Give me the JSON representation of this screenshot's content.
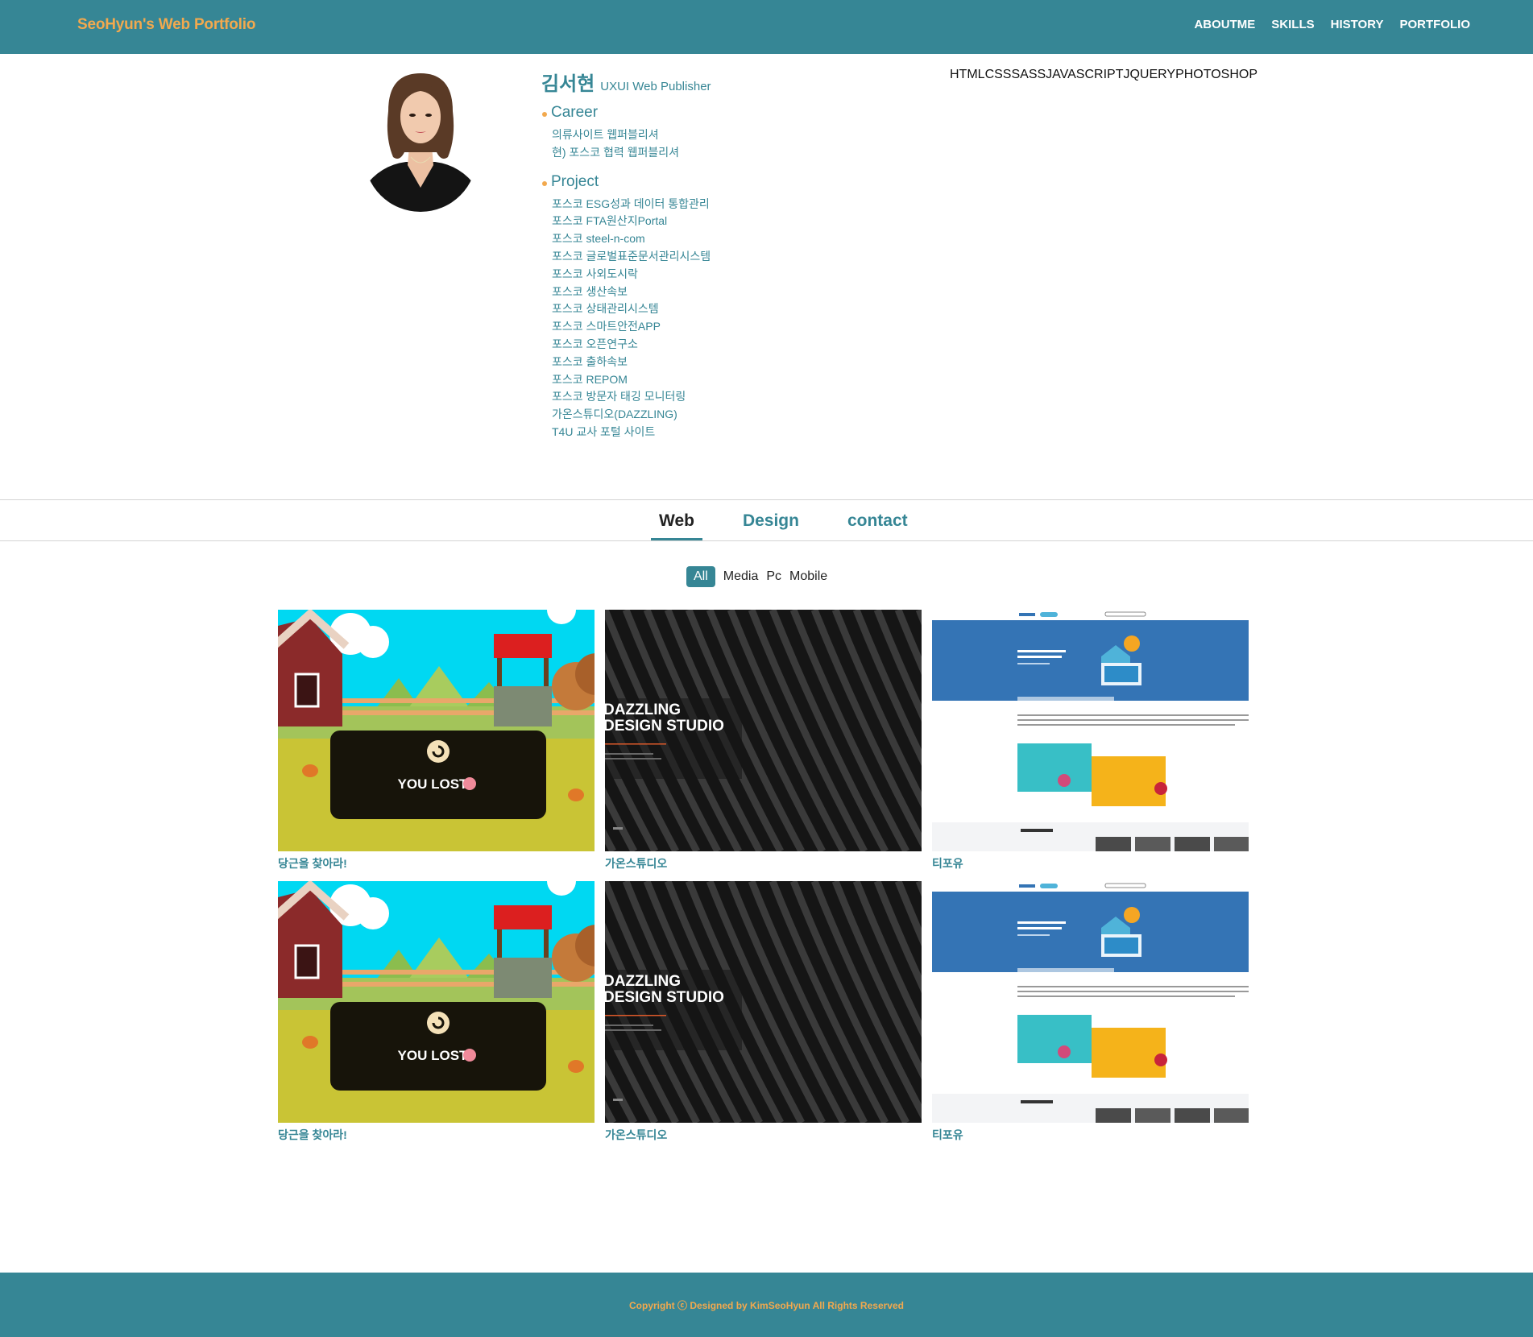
{
  "header": {
    "brand": "SeoHyun's Web Portfolio",
    "nav": [
      "ABOUTME",
      "SKILLS",
      "HISTORY",
      "PORTFOLIO"
    ]
  },
  "profile": {
    "name": "김서현",
    "role": "UXUI Web Publisher",
    "career_title": "Career",
    "career": [
      "의류사이트 웹퍼블리셔",
      "현) 포스코 협력 웹퍼블리셔"
    ],
    "project_title": "Project",
    "projects": [
      "포스코 ESG성과 데이터 통합관리",
      "포스코 FTA원산지Portal",
      "포스코 steel-n-com",
      "포스코 글로벌표준문서관리시스템",
      "포스코 사외도시락",
      "포스코 생산속보",
      "포스코 상태관리시스템",
      "포스코 스마트안전APP",
      "포스코 오픈연구소",
      "포스코 출하속보",
      "포스코 REPOM",
      "포스코 방문자 태깅 모니터링",
      "가온스튜디오(DAZZLING)",
      "T4U 교사 포털 사이트"
    ]
  },
  "skills": [
    "HTML",
    "CSS",
    "SASS",
    "JAVASCRIPT",
    "JQUERY",
    "PHOTOSHOP"
  ],
  "tabs": [
    "Web",
    "Design",
    "contact"
  ],
  "filters": [
    "All",
    "Media",
    "Pc",
    "Mobile"
  ],
  "cards": [
    {
      "title": "당근을 찾아라!",
      "kind": "game",
      "overlay": "YOU LOST"
    },
    {
      "title": "가온스튜디오",
      "kind": "studio",
      "overlay": "DAZZLING DESIGN STUDIO"
    },
    {
      "title": "티포유",
      "kind": "t4u"
    },
    {
      "title": "당근을 찾아라!",
      "kind": "game",
      "overlay": "YOU LOST"
    },
    {
      "title": "가온스튜디오",
      "kind": "studio",
      "overlay": "DAZZLING DESIGN STUDIO"
    },
    {
      "title": "티포유",
      "kind": "t4u"
    }
  ],
  "footer": {
    "copyright": "Copyright ⓒ Designed by KimSeoHyun All Rights Reserved"
  },
  "colors": {
    "primary": "#368695",
    "accent": "#f2a94e"
  }
}
